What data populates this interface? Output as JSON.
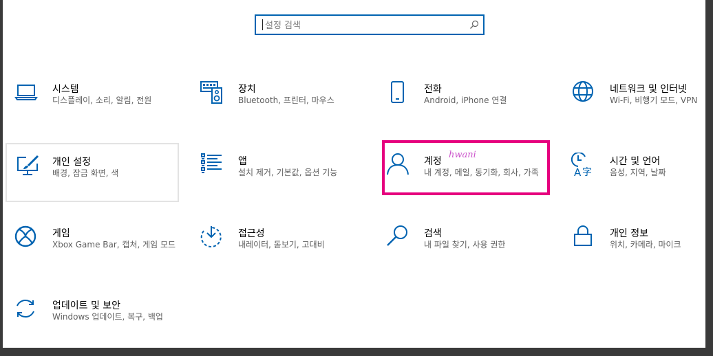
{
  "search": {
    "placeholder": "설정 검색"
  },
  "tiles": [
    {
      "title": "시스템",
      "desc": "디스플레이, 소리, 알림, 전원"
    },
    {
      "title": "장치",
      "desc": "Bluetooth, 프린터, 마우스"
    },
    {
      "title": "전화",
      "desc": "Android, iPhone 연결"
    },
    {
      "title": "네트워크 및 인터넷",
      "desc": "Wi-Fi, 비행기 모드, VPN"
    },
    {
      "title": "개인 설정",
      "desc": "배경, 잠금 화면, 색"
    },
    {
      "title": "앱",
      "desc": "설치 제거, 기본값, 옵션 기능"
    },
    {
      "title": "계정",
      "desc": "내 계정, 메일, 동기화, 회사, 가족"
    },
    {
      "title": "시간 및 언어",
      "desc": "음성, 지역, 날짜"
    },
    {
      "title": "게임",
      "desc": "Xbox Game Bar, 캡처, 게임 모드"
    },
    {
      "title": "접근성",
      "desc": "내레이터, 돋보기, 고대비"
    },
    {
      "title": "검색",
      "desc": "내 파일 찾기, 사용 권한"
    },
    {
      "title": "개인 정보",
      "desc": "위치, 카메라, 마이크"
    },
    {
      "title": "업데이트 및 보안",
      "desc": "Windows 업데이트, 복구, 백업"
    }
  ],
  "annotation": {
    "text": "hwani"
  },
  "colors": {
    "accent": "#0063b1",
    "highlight": "#e6007e"
  }
}
